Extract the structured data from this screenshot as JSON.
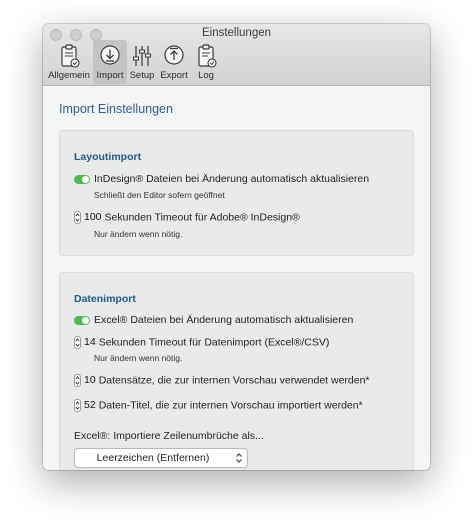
{
  "window": {
    "title": "Einstellungen"
  },
  "toolbar": {
    "items": [
      {
        "label": "Allgemein",
        "icon": "general-settings-icon"
      },
      {
        "label": "Import",
        "icon": "import-download-icon",
        "active": true
      },
      {
        "label": "Setup",
        "icon": "setup-sliders-icon"
      },
      {
        "label": "Export",
        "icon": "export-upload-icon"
      },
      {
        "label": "Log",
        "icon": "log-document-icon"
      }
    ]
  },
  "main": {
    "title": "Import Einstellungen",
    "layoutimport": {
      "heading": "Layoutimport",
      "auto_update_label": "InDesign® Dateien bei Änderung automatisch aktualisieren",
      "auto_update_on": true,
      "auto_update_hint": "Schließt den Editor sofern geöffnet",
      "timeout_value": "100",
      "timeout_label": "Sekunden Timeout für Adobe® InDesign®",
      "timeout_hint": "Nur ändern wenn nötig."
    },
    "datenimport": {
      "heading": "Datenimport",
      "auto_update_label": "Excel® Dateien bei Änderung automatisch aktualisieren",
      "auto_update_on": true,
      "timeout_value": "14",
      "timeout_label": "Sekunden Timeout für Datenimport (Excel®/CSV)",
      "timeout_hint": "Nur ändern wenn nötig.",
      "preview_records_value": "10",
      "preview_records_label": "Datensätze, die zur internen Vorschau verwendet werden*",
      "preview_titles_value": "52",
      "preview_titles_label": "Daten-Titel, die zur internen Vorschau importiert werden*",
      "linebreak_label": "Excel®: Importiere Zeilenumbrüche als...",
      "linebreak_selected": "Leerzeichen (Entfernen)"
    }
  },
  "colors": {
    "accent": "#2d5f8c",
    "toggle_on": "#4cbc52"
  }
}
